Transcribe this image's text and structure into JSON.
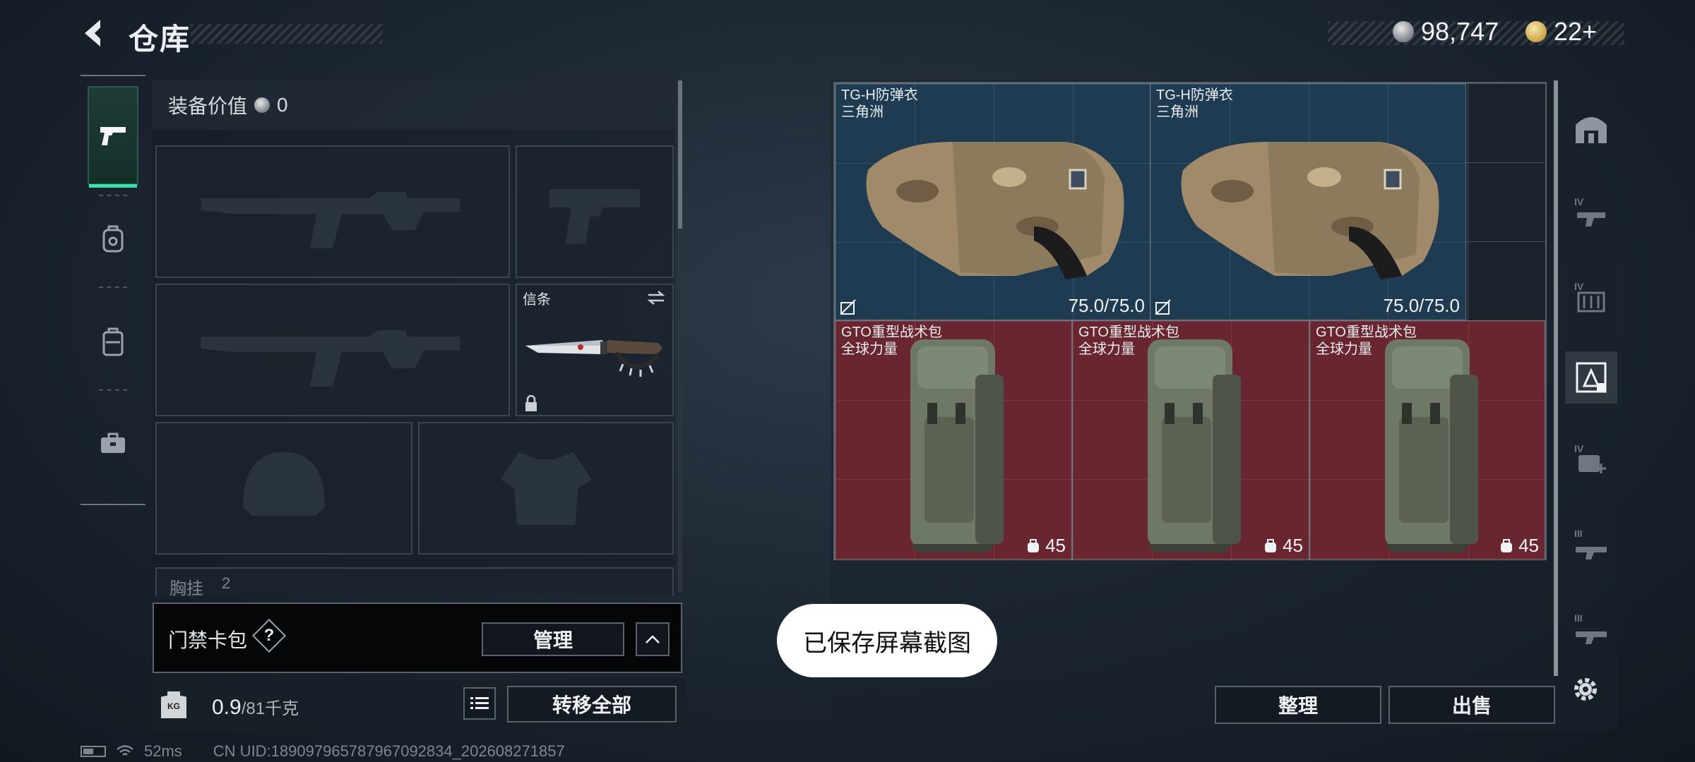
{
  "header": {
    "title": "仓库"
  },
  "currency": {
    "silver": "98,747",
    "gold": "22+"
  },
  "left_tabs": [
    "pistol-icon",
    "backpack-icon",
    "chest-rig-icon",
    "toolbox-icon"
  ],
  "equipment": {
    "value_label": "装备价值",
    "value": "0",
    "melee_label": "信条",
    "chest_rig_label": "胸挂",
    "chest_rig_count": "2"
  },
  "card_pack": {
    "label": "门禁卡包",
    "help": "?",
    "manage": "管理"
  },
  "weight": {
    "current": "0.9",
    "max": "/81千克",
    "transfer_all": "转移全部"
  },
  "items": {
    "vest1": {
      "name": "TG-H防弹衣",
      "sub": "三角洲",
      "durability": "75.0/75.0"
    },
    "vest2": {
      "name": "TG-H防弹衣",
      "sub": "三角洲",
      "durability": "75.0/75.0"
    },
    "bag1": {
      "name": "GTO重型战术包",
      "sub": "全球力量",
      "level": "45"
    },
    "bag2": {
      "name": "GTO重型战术包",
      "sub": "全球力量",
      "level": "45"
    },
    "bag3": {
      "name": "GTO重型战术包",
      "sub": "全球力量",
      "level": "45"
    }
  },
  "actions": {
    "sort": "整理",
    "sell": "出售"
  },
  "toast": "已保存屏幕截图",
  "status_bar": {
    "ping": "52ms",
    "uid": "CN UID:18909796578796709283​4_202608271857"
  },
  "colors": {
    "accent": "#3fe0a8",
    "vest_bg": "#1f3b52",
    "bag_bg": "#6a2630"
  }
}
